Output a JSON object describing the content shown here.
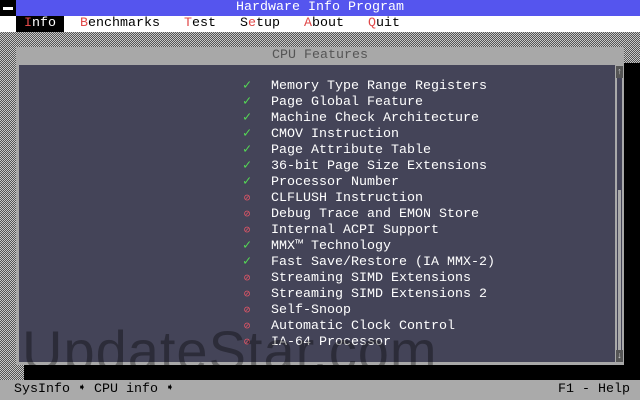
{
  "window": {
    "title": "Hardware Info Program"
  },
  "menu": [
    {
      "hotkey": "I",
      "rest": "nfo",
      "active": true
    },
    {
      "hotkey": "B",
      "rest": "enchmarks"
    },
    {
      "hotkey": "T",
      "rest": "est"
    },
    {
      "pre": "S",
      "hotkey": "e",
      "rest": "tup"
    },
    {
      "hotkey": "A",
      "rest": "bout"
    },
    {
      "hotkey": "Q",
      "rest": "uit"
    }
  ],
  "panel": {
    "title": "CPU Features"
  },
  "features": [
    {
      "label": "Memory Type Range Registers",
      "supported": true
    },
    {
      "label": "Page Global Feature",
      "supported": true
    },
    {
      "label": "Machine Check Architecture",
      "supported": true
    },
    {
      "label": "CMOV Instruction",
      "supported": true
    },
    {
      "label": "Page Attribute Table",
      "supported": true
    },
    {
      "label": "36-bit Page Size Extensions",
      "supported": true
    },
    {
      "label": "Processor Number",
      "supported": true
    },
    {
      "label": "CLFLUSH Instruction",
      "supported": false
    },
    {
      "label": "Debug Trace and EMON Store",
      "supported": false
    },
    {
      "label": "Internal ACPI Support",
      "supported": false
    },
    {
      "label": "MMX™ Technology",
      "supported": true
    },
    {
      "label": "Fast Save/Restore (IA MMX-2)",
      "supported": true
    },
    {
      "label": "Streaming SIMD Extensions",
      "supported": false
    },
    {
      "label": "Streaming SIMD Extensions 2",
      "supported": false
    },
    {
      "label": "Self-Snoop",
      "supported": false
    },
    {
      "label": "Automatic Clock Control",
      "supported": false
    },
    {
      "label": "IA-64 Processor",
      "supported": false
    }
  ],
  "icons": {
    "ok": "✓",
    "no": "⊘"
  },
  "scrollbar": {
    "up": "↑",
    "down": "↓",
    "thumb_start": 0.42,
    "thumb_end": 0.97
  },
  "watermark": "UpdateStar.com",
  "status": {
    "breadcrumb": "SysInfo ➧ CPU info ➧",
    "help": "F1 - Help"
  }
}
